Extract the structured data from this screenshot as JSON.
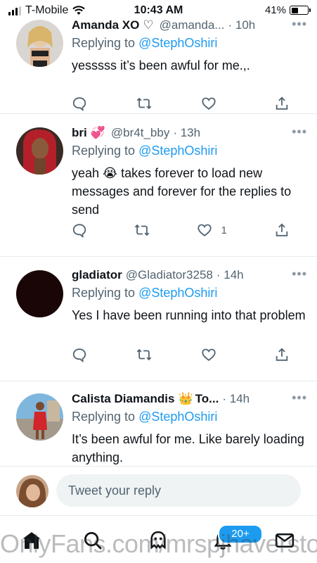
{
  "status_bar": {
    "carrier": "T-Mobile",
    "time": "10:43 AM",
    "battery_percent": "41%",
    "battery_level": 0.41
  },
  "tweets": [
    {
      "name": "Amanda XO",
      "badge": "♡",
      "handle": "@amanda...",
      "time": "· 10h",
      "replying_prefix": "Replying to",
      "replying_to": "@StephOshiri",
      "body": "yesssss it’s been awful for me.,.",
      "like_count": ""
    },
    {
      "name": "bri",
      "badge": "💞",
      "handle": "@br4t_bby",
      "time": "· 13h",
      "replying_prefix": "Replying to",
      "replying_to": "@StephOshiri",
      "body": "yeah 😭 takes forever to load new messages and forever for the replies to send",
      "like_count": "1"
    },
    {
      "name": "gladiator",
      "badge": "",
      "handle": "@Gladiator3258",
      "time": "· 14h",
      "replying_prefix": "Replying to",
      "replying_to": "@StephOshiri",
      "body": "Yes I have been running into that problem",
      "like_count": ""
    },
    {
      "name": "Calista Diamandis",
      "badge": "👑",
      "handle": "To...",
      "time": "· 14h",
      "replying_prefix": "Replying to",
      "replying_to": "@StephOshiri",
      "body": "It’s been awful for me. Like barely loading anything.",
      "like_count": ""
    }
  ],
  "reply_bar": {
    "placeholder": "Tweet your reply"
  },
  "tab_bar": {
    "notifications_badge": "20+"
  },
  "watermark": "OnlyFans.com/mrspjhaverstock",
  "icons": {
    "reply": "reply-icon",
    "retweet": "retweet-icon",
    "like": "heart-icon",
    "share": "share-icon",
    "more": "more-icon",
    "home": "home-icon",
    "search": "search-icon",
    "spaces": "spaces-icon",
    "notifications": "bell-icon",
    "messages": "mail-icon"
  },
  "colors": {
    "accent": "#1d9bf0",
    "secondary_text": "#536471",
    "divider": "#e6ecf0",
    "input_bg": "#eff3f4"
  }
}
